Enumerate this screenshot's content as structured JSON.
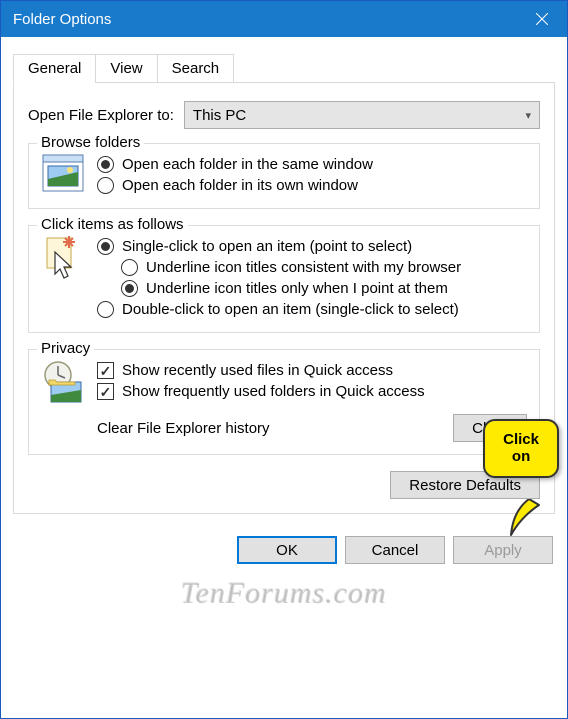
{
  "window": {
    "title": "Folder Options"
  },
  "tabs": {
    "general": "General",
    "view": "View",
    "search": "Search"
  },
  "open_explorer": {
    "label": "Open File Explorer to:",
    "value": "This PC"
  },
  "browse_folders": {
    "title": "Browse folders",
    "same_window": "Open each folder in the same window",
    "own_window": "Open each folder in its own window"
  },
  "click_items": {
    "title": "Click items as follows",
    "single_click": "Single-click to open an item (point to select)",
    "underline_browser": "Underline icon titles consistent with my browser",
    "underline_point": "Underline icon titles only when I point at them",
    "double_click": "Double-click to open an item (single-click to select)"
  },
  "privacy": {
    "title": "Privacy",
    "show_recent_files": "Show recently used files in Quick access",
    "show_frequent_folders": "Show frequently used folders in Quick access",
    "clear_label": "Clear File Explorer history",
    "clear_button": "Clear"
  },
  "restore_defaults": "Restore Defaults",
  "buttons": {
    "ok": "OK",
    "cancel": "Cancel",
    "apply": "Apply"
  },
  "callout": {
    "line1": "Click",
    "line2": "on"
  },
  "watermark": "TenForums.com"
}
